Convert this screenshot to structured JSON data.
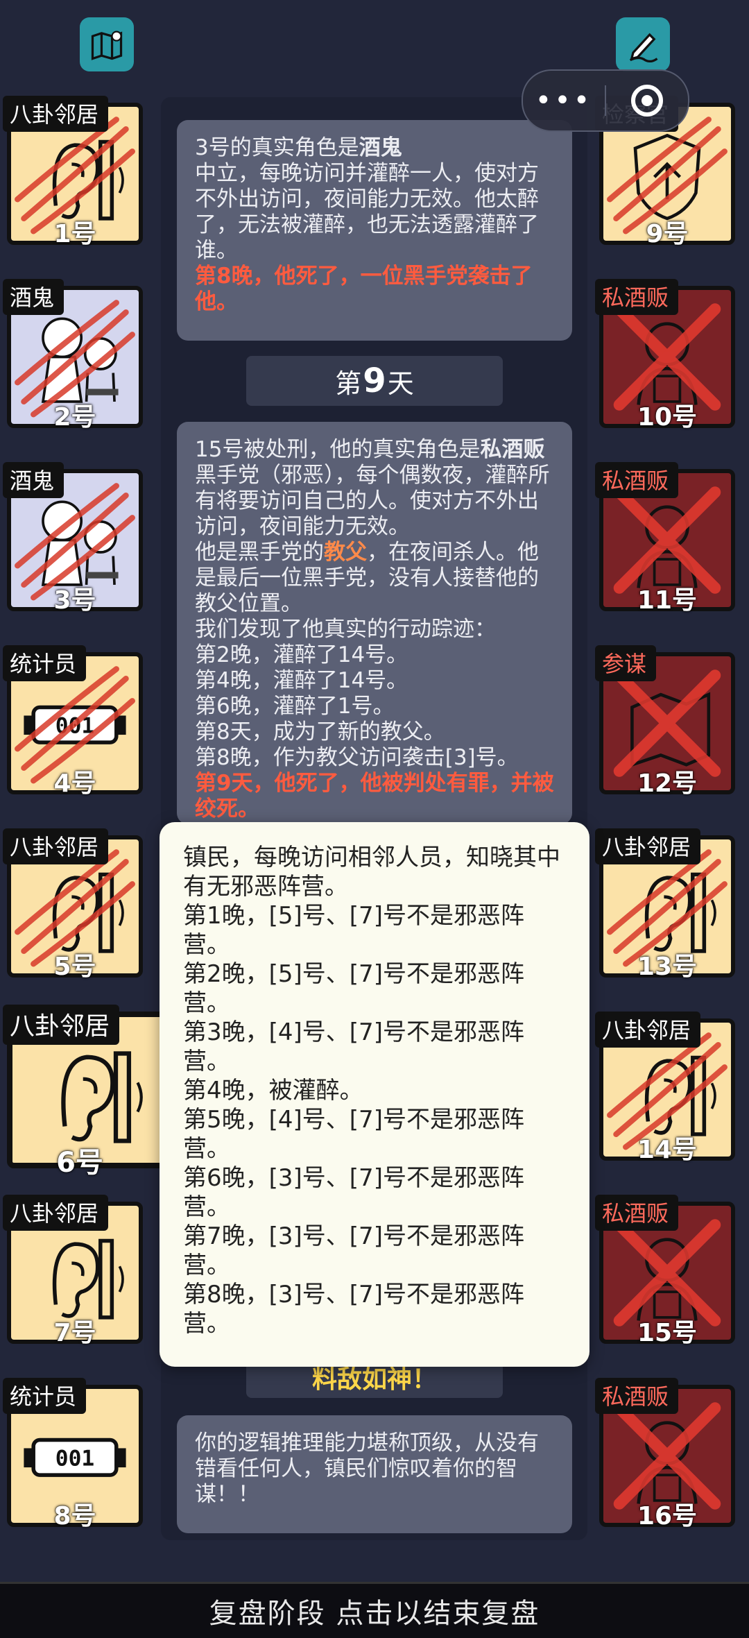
{
  "top_left_icon": "map-icon",
  "top_right_icon": "notes-icon",
  "capsule": {
    "menu_glyph": "•••"
  },
  "cards": [
    {
      "role": "八卦邻居",
      "number": "1号",
      "icon": "ear-icon",
      "state": "dead"
    },
    {
      "role": "酒鬼",
      "number": "2号",
      "icon": "drunk-icon",
      "state": "dead"
    },
    {
      "role": "酒鬼",
      "number": "3号",
      "icon": "drunk-icon",
      "state": "dead"
    },
    {
      "role": "统计员",
      "number": "4号",
      "icon": "counter-icon",
      "state": "dead"
    },
    {
      "role": "八卦邻居",
      "number": "5号",
      "icon": "ear-icon",
      "state": "dead"
    },
    {
      "role": "八卦邻居",
      "number": "6号",
      "icon": "ear-icon",
      "state": "alive-selected"
    },
    {
      "role": "八卦邻居",
      "number": "7号",
      "icon": "ear-icon",
      "state": "alive"
    },
    {
      "role": "统计员",
      "number": "8号",
      "icon": "counter-icon",
      "state": "alive"
    },
    {
      "role": "检察官",
      "number": "9号",
      "icon": "badge-icon",
      "state": "dead"
    },
    {
      "role": "私酒贩",
      "number": "10号",
      "icon": "bootlegger-icon",
      "state": "executed"
    },
    {
      "role": "私酒贩",
      "number": "11号",
      "icon": "bootlegger-icon",
      "state": "executed"
    },
    {
      "role": "参谋",
      "number": "12号",
      "icon": "map-icon",
      "state": "executed"
    },
    {
      "role": "八卦邻居",
      "number": "13号",
      "icon": "ear-icon",
      "state": "dead"
    },
    {
      "role": "八卦邻居",
      "number": "14号",
      "icon": "ear-icon",
      "state": "dead"
    },
    {
      "role": "私酒贩",
      "number": "15号",
      "icon": "bootlegger-icon",
      "state": "executed"
    },
    {
      "role": "私酒贩",
      "number": "16号",
      "icon": "bootlegger-icon",
      "state": "executed"
    }
  ],
  "log": {
    "msg1": {
      "title_pre": "3号的真实角色是",
      "title_bold": "酒鬼",
      "body": "中立，每晚访问并灌醉一人，使对方不外出访问，夜间能力无效。他太醉了，无法被灌醉，也无法透露灌醉了谁。",
      "death": "第8晚，他死了，一位黑手党袭击了他。"
    },
    "day": {
      "pre": "第",
      "num": "9",
      "post": "天"
    },
    "msg2": {
      "title_pre": "15号被处刑，他的真实角色是",
      "title_bold": "私酒贩",
      "line1": "黑手党（邪恶），每个偶数夜，灌醉所有将要访问自己的人。使对方不外出访问，夜间能力无效。",
      "line2_pre": "他是黑手党的",
      "line2_hl": "教父",
      "line2_post": "，在夜间杀人。他是最后一位黑手党，没有人接替他的教父位置。",
      "line3": "我们发现了他真实的行动踪迹：",
      "tracks": [
        "第2晚，灌醉了14号。",
        "第4晚，灌醉了14号。",
        "第6晚，灌醉了1号。",
        "第8天，成为了新的教父。",
        "第8晚，作为教父访问袭击[3]号。"
      ],
      "death": "第9天，他死了，他被判处有罪，并被绞死。"
    },
    "gold": "料敌如神！",
    "msg3": "你的逻辑推理能力堪称顶级，从没有错看任何人，镇民们惊叹着你的智谋！！"
  },
  "popup": {
    "lines": [
      "镇民，每晚访问相邻人员，知晓其中有无邪恶阵营。",
      "第1晚，[5]号、[7]号不是邪恶阵营。",
      "第2晚，[5]号、[7]号不是邪恶阵营。",
      "第3晚，[4]号、[7]号不是邪恶阵营。",
      "第4晚，被灌醉。",
      "第5晚，[4]号、[7]号不是邪恶阵营。",
      "第6晚，[3]号、[7]号不是邪恶阵营。",
      "第7晚，[3]号、[7]号不是邪恶阵营。",
      "第8晚，[3]号、[7]号不是邪恶阵营。"
    ]
  },
  "bottom_bar": "复盘阶段 点击以结束复盘"
}
